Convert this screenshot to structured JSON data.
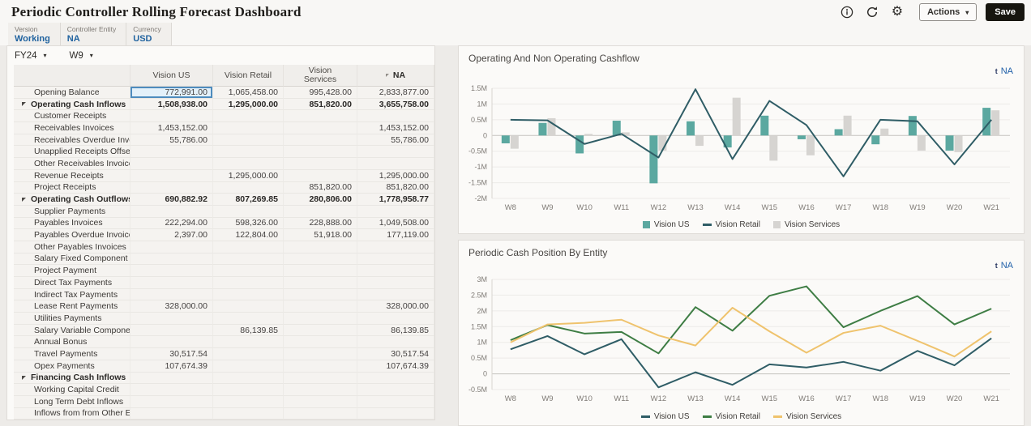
{
  "header": {
    "title": "Periodic Controller Rolling Forecast Dashboard",
    "actions_label": "Actions",
    "save_label": "Save"
  },
  "pov": {
    "fields": [
      {
        "label": "Version",
        "value": "Working"
      },
      {
        "label": "Controller Entity",
        "value": "NA"
      },
      {
        "label": "Currency",
        "value": "USD"
      }
    ]
  },
  "grid": {
    "year_selector": "FY24",
    "week_selector": "W9",
    "columns": [
      "Vision US",
      "Vision Retail",
      "Vision Services",
      "NA"
    ],
    "selected_cell": {
      "row": 0,
      "col": 0
    },
    "rows": [
      {
        "label": "Opening Balance",
        "level": 1,
        "bold": false,
        "values": [
          "772,991.00",
          "1,065,458.00",
          "995,428.00",
          "2,833,877.00"
        ]
      },
      {
        "label": "Operating Cash Inflows",
        "level": 0,
        "bold": true,
        "values": [
          "1,508,938.00",
          "1,295,000.00",
          "851,820.00",
          "3,655,758.00"
        ]
      },
      {
        "label": "Customer Receipts",
        "level": 1,
        "bold": false,
        "values": [
          "",
          "",
          "",
          ""
        ]
      },
      {
        "label": "Receivables Invoices",
        "level": 1,
        "bold": false,
        "values": [
          "1,453,152.00",
          "",
          "",
          "1,453,152.00"
        ]
      },
      {
        "label": "Receivables Overdue Invoices",
        "level": 1,
        "bold": false,
        "values": [
          "55,786.00",
          "",
          "",
          "55,786.00"
        ]
      },
      {
        "label": "Unapplied Receipts Offset",
        "level": 1,
        "bold": false,
        "values": [
          "",
          "",
          "",
          ""
        ]
      },
      {
        "label": "Other Receivables Invoices",
        "level": 1,
        "bold": false,
        "values": [
          "",
          "",
          "",
          ""
        ]
      },
      {
        "label": "Revenue Receipts",
        "level": 1,
        "bold": false,
        "values": [
          "",
          "1,295,000.00",
          "",
          "1,295,000.00"
        ]
      },
      {
        "label": "Project Receipts",
        "level": 1,
        "bold": false,
        "values": [
          "",
          "",
          "851,820.00",
          "851,820.00"
        ]
      },
      {
        "label": "Operating Cash Outflows",
        "level": 0,
        "bold": true,
        "values": [
          "690,882.92",
          "807,269.85",
          "280,806.00",
          "1,778,958.77"
        ]
      },
      {
        "label": "Supplier Payments",
        "level": 1,
        "bold": false,
        "values": [
          "",
          "",
          "",
          ""
        ]
      },
      {
        "label": "Payables Invoices",
        "level": 1,
        "bold": false,
        "values": [
          "222,294.00",
          "598,326.00",
          "228,888.00",
          "1,049,508.00"
        ]
      },
      {
        "label": "Payables Overdue Invoices",
        "level": 1,
        "bold": false,
        "values": [
          "2,397.00",
          "122,804.00",
          "51,918.00",
          "177,119.00"
        ]
      },
      {
        "label": "Other Payables Invoices",
        "level": 1,
        "bold": false,
        "values": [
          "",
          "",
          "",
          ""
        ]
      },
      {
        "label": "Salary Fixed Component",
        "level": 1,
        "bold": false,
        "values": [
          "",
          "",
          "",
          ""
        ]
      },
      {
        "label": "Project Payment",
        "level": 1,
        "bold": false,
        "values": [
          "",
          "",
          "",
          ""
        ]
      },
      {
        "label": "Direct Tax Payments",
        "level": 1,
        "bold": false,
        "values": [
          "",
          "",
          "",
          ""
        ]
      },
      {
        "label": "Indirect Tax Payments",
        "level": 1,
        "bold": false,
        "values": [
          "",
          "",
          "",
          ""
        ]
      },
      {
        "label": "Lease Rent Payments",
        "level": 1,
        "bold": false,
        "values": [
          "328,000.00",
          "",
          "",
          "328,000.00"
        ]
      },
      {
        "label": "Utilities Payments",
        "level": 1,
        "bold": false,
        "values": [
          "",
          "",
          "",
          ""
        ]
      },
      {
        "label": "Salary Variable Component",
        "level": 1,
        "bold": false,
        "values": [
          "",
          "86,139.85",
          "",
          "86,139.85"
        ]
      },
      {
        "label": "Annual Bonus",
        "level": 1,
        "bold": false,
        "values": [
          "",
          "",
          "",
          ""
        ]
      },
      {
        "label": "Travel Payments",
        "level": 1,
        "bold": false,
        "values": [
          "30,517.54",
          "",
          "",
          "30,517.54"
        ]
      },
      {
        "label": "Opex Payments",
        "level": 1,
        "bold": false,
        "values": [
          "107,674.39",
          "",
          "",
          "107,674.39"
        ]
      },
      {
        "label": "Financing Cash Inflows",
        "level": 0,
        "bold": true,
        "values": [
          "",
          "",
          "",
          ""
        ]
      },
      {
        "label": "Working Capital Credit",
        "level": 1,
        "bold": false,
        "values": [
          "",
          "",
          "",
          ""
        ]
      },
      {
        "label": "Long Term Debt Inflows",
        "level": 1,
        "bold": false,
        "values": [
          "",
          "",
          "",
          ""
        ]
      },
      {
        "label": "Inflows from from Other Entities",
        "level": 1,
        "bold": false,
        "values": [
          "",
          "",
          "",
          ""
        ]
      }
    ]
  },
  "chart_data": [
    {
      "type": "combo",
      "title": "Operating And Non Operating Cashflow",
      "pov_label": "NA",
      "categories": [
        "W8",
        "W9",
        "W10",
        "W11",
        "W12",
        "W13",
        "W14",
        "W15",
        "W16",
        "W17",
        "W18",
        "W19",
        "W20",
        "W21"
      ],
      "ylim": [
        -2,
        1.5
      ],
      "ystep": 0.5,
      "yticks": [
        "1.5M",
        "1M",
        "0.5M",
        "0",
        "-0.5M",
        "-1M",
        "-1.5M",
        "-2M"
      ],
      "unit": "M",
      "legend_position": "bottom",
      "grid": true,
      "series": [
        {
          "name": "Vision US",
          "type": "bar",
          "color": "#5BA8A0",
          "values": [
            -0.25,
            0.4,
            -0.57,
            0.47,
            -1.52,
            0.45,
            -0.38,
            0.63,
            -0.12,
            0.2,
            -0.28,
            0.62,
            -0.48,
            0.88
          ]
        },
        {
          "name": "Vision Retail",
          "type": "line",
          "color": "#2F5D66",
          "values": [
            0.5,
            0.48,
            -0.27,
            0.05,
            -0.7,
            1.47,
            -0.75,
            1.1,
            0.33,
            -1.3,
            0.5,
            0.45,
            -0.92,
            0.5
          ]
        },
        {
          "name": "Vision Services",
          "type": "bar",
          "color": "#D6D4D1",
          "values": [
            -0.42,
            0.55,
            0.05,
            0.1,
            -0.48,
            -0.33,
            1.2,
            -0.8,
            -0.63,
            0.63,
            0.22,
            -0.48,
            -0.53,
            0.8
          ]
        }
      ]
    },
    {
      "type": "line",
      "title": "Periodic Cash Position By Entity",
      "pov_label": "NA",
      "categories": [
        "W8",
        "W9",
        "W10",
        "W11",
        "W12",
        "W13",
        "W14",
        "W15",
        "W16",
        "W17",
        "W18",
        "W19",
        "W20",
        "W21"
      ],
      "ylim": [
        -0.5,
        3
      ],
      "ystep": 0.5,
      "yticks": [
        "3M",
        "2.5M",
        "2M",
        "1.5M",
        "1M",
        "0.5M",
        "0",
        "-0.5M"
      ],
      "unit": "M",
      "legend_position": "bottom",
      "grid": true,
      "series": [
        {
          "name": "Vision US",
          "type": "line",
          "color": "#2F5D66",
          "values": [
            0.78,
            1.2,
            0.62,
            1.1,
            -0.43,
            0.05,
            -0.35,
            0.3,
            0.2,
            0.38,
            0.1,
            0.73,
            0.27,
            1.13
          ]
        },
        {
          "name": "Vision Retail",
          "type": "line",
          "color": "#3E7D44",
          "values": [
            1.07,
            1.55,
            1.28,
            1.33,
            0.65,
            2.12,
            1.37,
            2.48,
            2.78,
            1.48,
            2.0,
            2.47,
            1.57,
            2.07
          ]
        },
        {
          "name": "Vision Services",
          "type": "line",
          "color": "#EFC36D",
          "values": [
            1.0,
            1.57,
            1.62,
            1.72,
            1.22,
            0.9,
            2.1,
            1.35,
            0.67,
            1.3,
            1.53,
            1.05,
            0.55,
            1.35
          ]
        }
      ]
    }
  ],
  "colors": {
    "accent_blue": "#21639F",
    "teal": "#5BA8A0",
    "dark_teal": "#2F5D66",
    "green": "#3E7D44",
    "amber": "#EFC36D",
    "gray_bar": "#D6D4D1",
    "save_button": "#17150F"
  }
}
